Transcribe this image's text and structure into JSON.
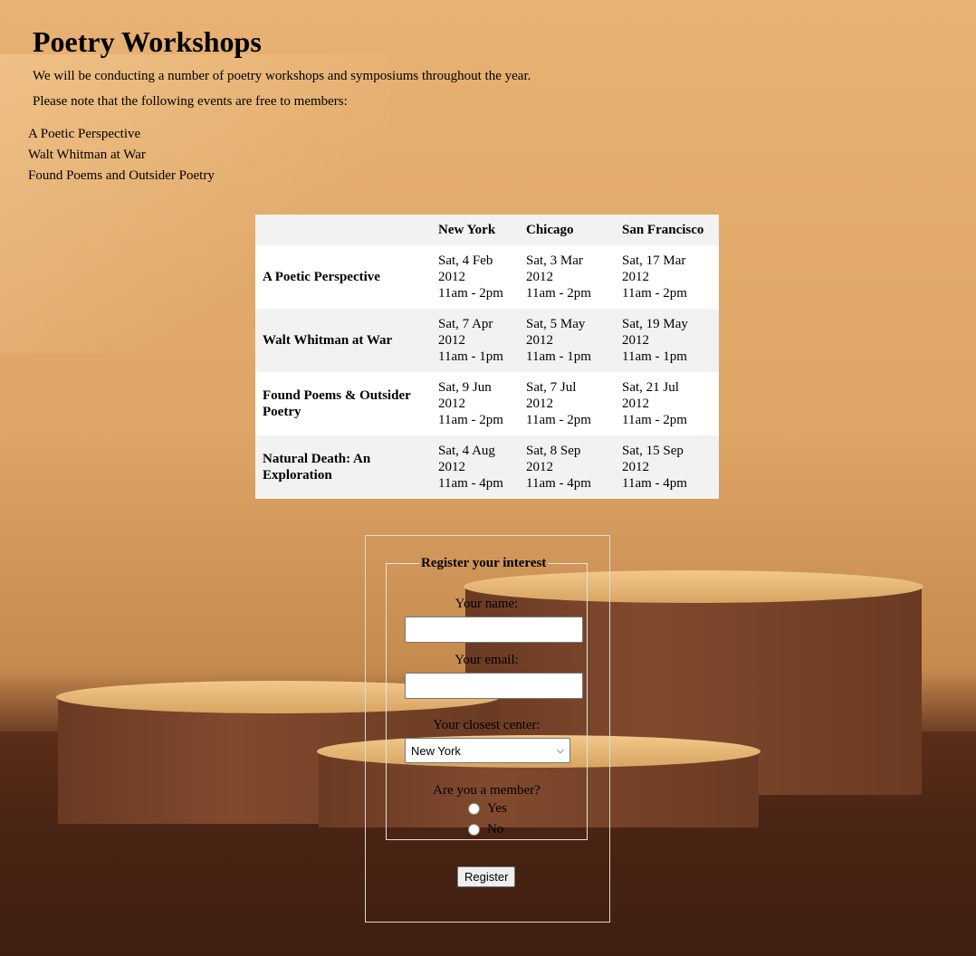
{
  "page": {
    "title": "Poetry Workshops",
    "intro": "We will be conducting a number of poetry workshops and symposiums throughout the year.",
    "free_note": "Please note that the following events are free to members:",
    "free_events": [
      "A Poetic Perspective",
      "Walt Whitman at War",
      "Found Poems and Outsider Poetry"
    ]
  },
  "schedule": {
    "headers": [
      "",
      "New York",
      "Chicago",
      "San Francisco"
    ],
    "rows": [
      {
        "event": "A Poetic Perspective",
        "cells": [
          {
            "date": "Sat, 4 Feb",
            "year": "2012",
            "time": "11am - 2pm"
          },
          {
            "date": "Sat, 3 Mar",
            "year": "2012",
            "time": "11am - 2pm"
          },
          {
            "date": "Sat, 17 Mar",
            "year": "2012",
            "time": "11am - 2pm"
          }
        ]
      },
      {
        "event": "Walt Whitman at War",
        "cells": [
          {
            "date": "Sat, 7 Apr",
            "year": "2012",
            "time": "11am - 1pm"
          },
          {
            "date": "Sat, 5 May",
            "year": "2012",
            "time": "11am - 1pm"
          },
          {
            "date": "Sat, 19 May",
            "year": "2012",
            "time": "11am - 1pm"
          }
        ]
      },
      {
        "event": "Found Poems & Outsider Poetry",
        "cells": [
          {
            "date": "Sat, 9 Jun",
            "year": "2012",
            "time": "11am - 2pm"
          },
          {
            "date": "Sat, 7 Jul",
            "year": "2012",
            "time": "11am - 2pm"
          },
          {
            "date": "Sat, 21 Jul",
            "year": "2012",
            "time": "11am - 2pm"
          }
        ]
      },
      {
        "event": "Natural Death: An Exploration",
        "cells": [
          {
            "date": "Sat, 4 Aug",
            "year": "2012",
            "time": "11am - 4pm"
          },
          {
            "date": "Sat, 8 Sep",
            "year": "2012",
            "time": "11am - 4pm"
          },
          {
            "date": "Sat, 15 Sep",
            "year": "2012",
            "time": "11am - 4pm"
          }
        ]
      }
    ]
  },
  "form": {
    "legend": "Register your interest",
    "name_label": "Your name:",
    "name_value": "",
    "email_label": "Your email:",
    "email_value": "",
    "center_label": "Your closest center:",
    "center_selected": "New York",
    "member_label": "Are you a member?",
    "member_options": [
      "Yes",
      "No"
    ],
    "submit_label": "Register"
  }
}
